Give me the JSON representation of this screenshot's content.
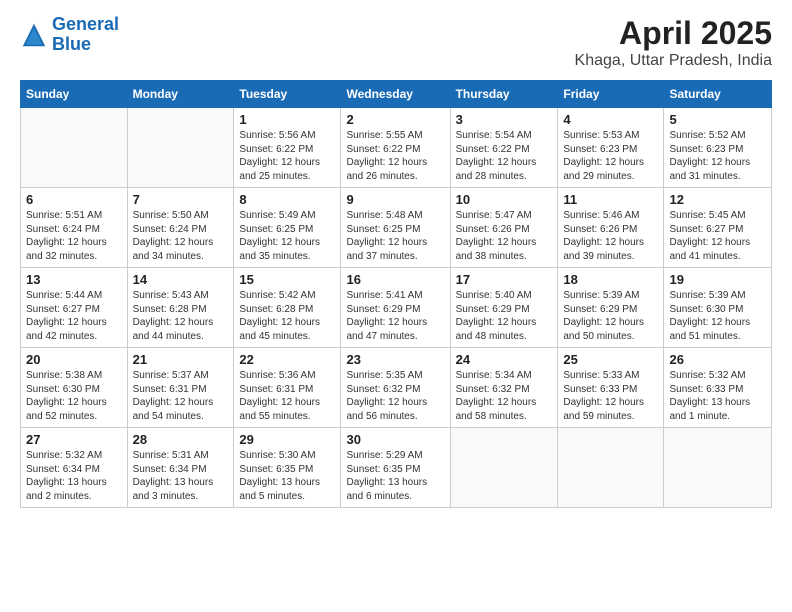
{
  "logo": {
    "line1": "General",
    "line2": "Blue"
  },
  "title": "April 2025",
  "location": "Khaga, Uttar Pradesh, India",
  "days_of_week": [
    "Sunday",
    "Monday",
    "Tuesday",
    "Wednesday",
    "Thursday",
    "Friday",
    "Saturday"
  ],
  "weeks": [
    [
      {
        "day": "",
        "info": ""
      },
      {
        "day": "",
        "info": ""
      },
      {
        "day": "1",
        "info": "Sunrise: 5:56 AM\nSunset: 6:22 PM\nDaylight: 12 hours and 25 minutes."
      },
      {
        "day": "2",
        "info": "Sunrise: 5:55 AM\nSunset: 6:22 PM\nDaylight: 12 hours and 26 minutes."
      },
      {
        "day": "3",
        "info": "Sunrise: 5:54 AM\nSunset: 6:22 PM\nDaylight: 12 hours and 28 minutes."
      },
      {
        "day": "4",
        "info": "Sunrise: 5:53 AM\nSunset: 6:23 PM\nDaylight: 12 hours and 29 minutes."
      },
      {
        "day": "5",
        "info": "Sunrise: 5:52 AM\nSunset: 6:23 PM\nDaylight: 12 hours and 31 minutes."
      }
    ],
    [
      {
        "day": "6",
        "info": "Sunrise: 5:51 AM\nSunset: 6:24 PM\nDaylight: 12 hours and 32 minutes."
      },
      {
        "day": "7",
        "info": "Sunrise: 5:50 AM\nSunset: 6:24 PM\nDaylight: 12 hours and 34 minutes."
      },
      {
        "day": "8",
        "info": "Sunrise: 5:49 AM\nSunset: 6:25 PM\nDaylight: 12 hours and 35 minutes."
      },
      {
        "day": "9",
        "info": "Sunrise: 5:48 AM\nSunset: 6:25 PM\nDaylight: 12 hours and 37 minutes."
      },
      {
        "day": "10",
        "info": "Sunrise: 5:47 AM\nSunset: 6:26 PM\nDaylight: 12 hours and 38 minutes."
      },
      {
        "day": "11",
        "info": "Sunrise: 5:46 AM\nSunset: 6:26 PM\nDaylight: 12 hours and 39 minutes."
      },
      {
        "day": "12",
        "info": "Sunrise: 5:45 AM\nSunset: 6:27 PM\nDaylight: 12 hours and 41 minutes."
      }
    ],
    [
      {
        "day": "13",
        "info": "Sunrise: 5:44 AM\nSunset: 6:27 PM\nDaylight: 12 hours and 42 minutes."
      },
      {
        "day": "14",
        "info": "Sunrise: 5:43 AM\nSunset: 6:28 PM\nDaylight: 12 hours and 44 minutes."
      },
      {
        "day": "15",
        "info": "Sunrise: 5:42 AM\nSunset: 6:28 PM\nDaylight: 12 hours and 45 minutes."
      },
      {
        "day": "16",
        "info": "Sunrise: 5:41 AM\nSunset: 6:29 PM\nDaylight: 12 hours and 47 minutes."
      },
      {
        "day": "17",
        "info": "Sunrise: 5:40 AM\nSunset: 6:29 PM\nDaylight: 12 hours and 48 minutes."
      },
      {
        "day": "18",
        "info": "Sunrise: 5:39 AM\nSunset: 6:29 PM\nDaylight: 12 hours and 50 minutes."
      },
      {
        "day": "19",
        "info": "Sunrise: 5:39 AM\nSunset: 6:30 PM\nDaylight: 12 hours and 51 minutes."
      }
    ],
    [
      {
        "day": "20",
        "info": "Sunrise: 5:38 AM\nSunset: 6:30 PM\nDaylight: 12 hours and 52 minutes."
      },
      {
        "day": "21",
        "info": "Sunrise: 5:37 AM\nSunset: 6:31 PM\nDaylight: 12 hours and 54 minutes."
      },
      {
        "day": "22",
        "info": "Sunrise: 5:36 AM\nSunset: 6:31 PM\nDaylight: 12 hours and 55 minutes."
      },
      {
        "day": "23",
        "info": "Sunrise: 5:35 AM\nSunset: 6:32 PM\nDaylight: 12 hours and 56 minutes."
      },
      {
        "day": "24",
        "info": "Sunrise: 5:34 AM\nSunset: 6:32 PM\nDaylight: 12 hours and 58 minutes."
      },
      {
        "day": "25",
        "info": "Sunrise: 5:33 AM\nSunset: 6:33 PM\nDaylight: 12 hours and 59 minutes."
      },
      {
        "day": "26",
        "info": "Sunrise: 5:32 AM\nSunset: 6:33 PM\nDaylight: 13 hours and 1 minute."
      }
    ],
    [
      {
        "day": "27",
        "info": "Sunrise: 5:32 AM\nSunset: 6:34 PM\nDaylight: 13 hours and 2 minutes."
      },
      {
        "day": "28",
        "info": "Sunrise: 5:31 AM\nSunset: 6:34 PM\nDaylight: 13 hours and 3 minutes."
      },
      {
        "day": "29",
        "info": "Sunrise: 5:30 AM\nSunset: 6:35 PM\nDaylight: 13 hours and 5 minutes."
      },
      {
        "day": "30",
        "info": "Sunrise: 5:29 AM\nSunset: 6:35 PM\nDaylight: 13 hours and 6 minutes."
      },
      {
        "day": "",
        "info": ""
      },
      {
        "day": "",
        "info": ""
      },
      {
        "day": "",
        "info": ""
      }
    ]
  ]
}
